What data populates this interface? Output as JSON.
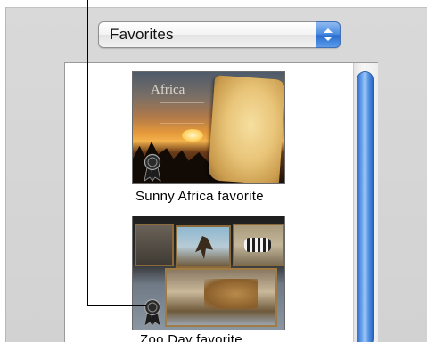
{
  "popup": {
    "selected": "Favorites"
  },
  "items": [
    {
      "thumb_title": "Africa",
      "caption": "Sunny Africa favorite",
      "icon": "ribbon-award-icon"
    },
    {
      "caption": "Zoo Day favorite",
      "icon": "ribbon-award-icon"
    }
  ],
  "colors": {
    "window_bg": "#d6d6d6",
    "scroll_thumb": "#4f8fe2",
    "popup_arrows": "#2a6fd0"
  }
}
